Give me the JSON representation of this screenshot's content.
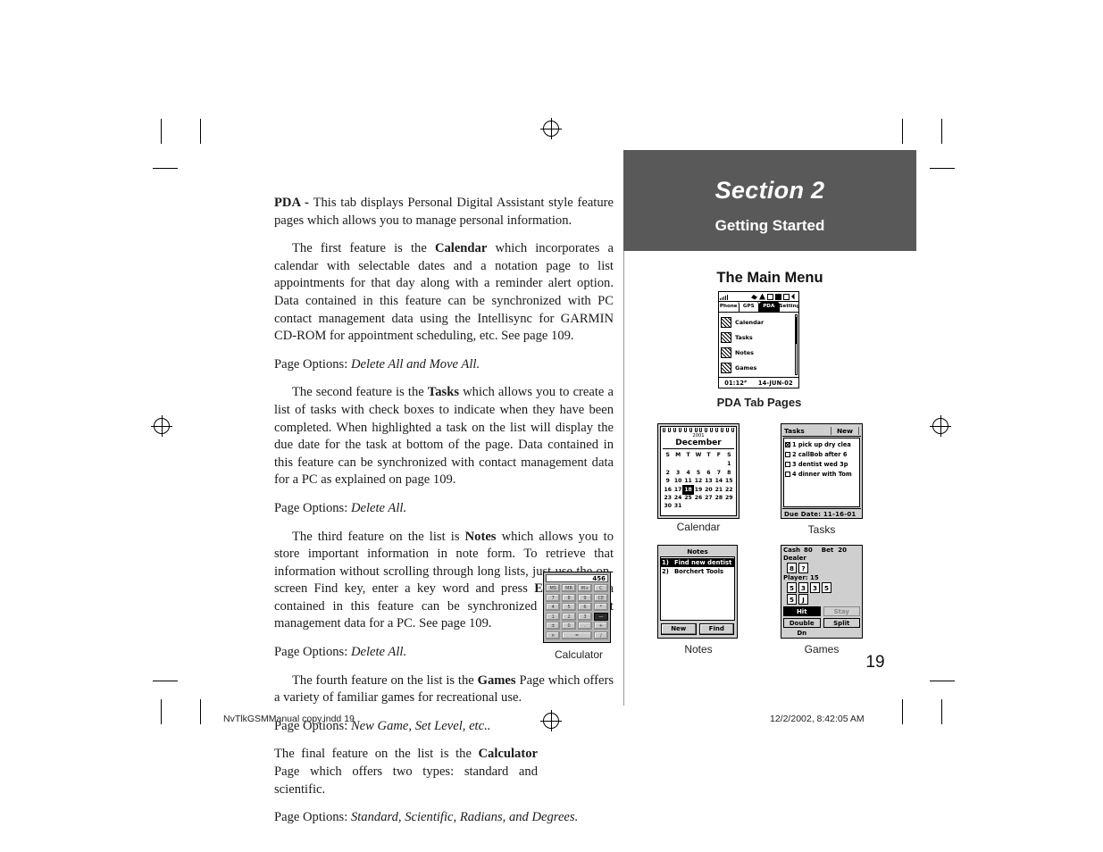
{
  "document": {
    "page_number": "19",
    "footer_left": "NvTlkGSMManual copy.indd   19",
    "footer_right": "12/2/2002, 8:42:05 AM"
  },
  "section": {
    "title": "Section 2",
    "subtitle": "Getting Started",
    "heading": "The Main Menu"
  },
  "body": {
    "p1_bold": "PDA - ",
    "p1": "This tab displays Personal Digital Assistant style feature pages which allows you to manage personal information.",
    "p2_a": "The first feature is the ",
    "p2_bold": "Calendar",
    "p2_b": " which incorporates a calendar with selectable dates and a notation page to list appointments for that day along with a reminder alert option. Data contained in this feature can be synchronized with PC contact management data using the Intellisync for GARMIN CD-ROM for appointment scheduling, etc. See page 109.",
    "opt1_label": "Page Options: ",
    "opt1_value": "Delete All and Move All.",
    "p3_a": "The second feature is the ",
    "p3_bold": "Tasks",
    "p3_b": " which allows you to create a list of tasks with check boxes to indicate when they have been completed. When highlighted a task on the list will display the due date for the task at bottom of the page. Data contained in this feature can be synchronized with contact management data for a PC as explained on page 109.",
    "opt2_label": "Page Options: ",
    "opt2_value": "Delete All.",
    "p4_a": "The third feature on the list is ",
    "p4_bold": "Notes",
    "p4_b": " which allows you to store important information in note form. To retrieve that information without scrolling through long lists, just use the on-screen Find key, enter a key word and press ",
    "p4_bold2": "ENTER",
    "p4_c": ". Data contained in this feature can be synchronized with contact management data for a PC. See page 109.",
    "opt3_label": "Page Options: ",
    "opt3_value": "Delete All.",
    "p5_a": "The fourth feature on the list is the ",
    "p5_bold": "Games",
    "p5_b": " Page which offers a variety of familiar games for recreational use.",
    "opt4_label": "Page Options: ",
    "opt4_value": "New Game, Set Level, etc..",
    "p6_a": "The final feature on the list is the ",
    "p6_bold": "Calculator",
    "p6_b": " Page which offers two types: standard and scientific.",
    "opt5_label": "Page Options: ",
    "opt5_value": "Standard, Scientific, Radians, and Degrees."
  },
  "captions": {
    "pda_tab_pages": "PDA Tab Pages",
    "calendar": "Calendar",
    "tasks": "Tasks",
    "notes": "Notes",
    "games": "Games",
    "calculator": "Calculator"
  },
  "main_menu": {
    "tabs": [
      {
        "label": "Phone",
        "active": false
      },
      {
        "label": "GPS",
        "active": false
      },
      {
        "label": "PDA",
        "active": true
      },
      {
        "label": "Settings",
        "active": false
      }
    ],
    "items": [
      {
        "label": "Calendar",
        "icon": "calendar-icon"
      },
      {
        "label": "Tasks",
        "icon": "tasks-icon"
      },
      {
        "label": "Notes",
        "icon": "notes-icon"
      },
      {
        "label": "Games",
        "icon": "games-icon"
      }
    ],
    "time": "01:12ᴾ",
    "date": "14-JUN-02"
  },
  "calendar_screen": {
    "year": "2001",
    "month": "December",
    "dow": [
      "S",
      "M",
      "T",
      "W",
      "T",
      "F",
      "S"
    ],
    "cells": [
      "",
      "",
      "",
      "",
      "",
      "",
      "1",
      "2",
      "3",
      "4",
      "5",
      "6",
      "7",
      "8",
      "9",
      "10",
      "11",
      "12",
      "13",
      "14",
      "15",
      "16",
      "17",
      "18",
      "19",
      "20",
      "21",
      "22",
      "23",
      "24",
      "25",
      "26",
      "27",
      "28",
      "29",
      "30",
      "31",
      "",
      "",
      "",
      "",
      ""
    ],
    "selected": "18"
  },
  "tasks_screen": {
    "title": "Tasks",
    "new_button": "New",
    "rows": [
      {
        "checked": true,
        "text": "1 pick up dry clea"
      },
      {
        "checked": false,
        "text": "2 callBob after 6"
      },
      {
        "checked": false,
        "text": "3 dentist wed 3p"
      },
      {
        "checked": false,
        "text": "4 dinner with Tom"
      }
    ],
    "footer": "Due Date: 11-16-01"
  },
  "notes_screen": {
    "title": "Notes",
    "rows": [
      {
        "num": "1)",
        "text": "Find new dentist",
        "selected": true
      },
      {
        "num": "2)",
        "text": "Borchert Tools",
        "selected": false
      }
    ],
    "buttons": [
      "New",
      "Find"
    ]
  },
  "games_screen": {
    "cash_label": "Cash",
    "cash_value": "80",
    "bet_label": "Bet",
    "bet_value": "20",
    "dealer_label": "Dealer",
    "dealer_cards": [
      "8",
      "?"
    ],
    "player_label": "Player: 15",
    "player_cards_row1": [
      "5",
      "3",
      "3",
      "5"
    ],
    "player_cards_row2": [
      "5",
      "J"
    ],
    "buttons": [
      {
        "label": "Hit",
        "state": "selected"
      },
      {
        "label": "Stay",
        "state": "disabled"
      },
      {
        "label": "Double Dn",
        "state": "normal"
      },
      {
        "label": "Split",
        "state": "normal"
      }
    ]
  },
  "calculator_screen": {
    "display": "456",
    "keys": [
      {
        "label": "MS",
        "style": "normal"
      },
      {
        "label": "MR",
        "style": "normal"
      },
      {
        "label": "M+",
        "style": "normal"
      },
      {
        "label": "C",
        "style": "normal"
      },
      {
        "label": "7",
        "style": "normal"
      },
      {
        "label": "8",
        "style": "normal"
      },
      {
        "label": "9",
        "style": "normal"
      },
      {
        "label": "CE",
        "style": "normal"
      },
      {
        "label": "4",
        "style": "normal"
      },
      {
        "label": "5",
        "style": "normal"
      },
      {
        "label": "6",
        "style": "normal"
      },
      {
        "label": "*",
        "style": "normal"
      },
      {
        "label": "1",
        "style": "normal"
      },
      {
        "label": "2",
        "style": "normal"
      },
      {
        "label": "3",
        "style": "normal"
      },
      {
        "label": "—",
        "style": "dark"
      },
      {
        "label": "±",
        "style": "normal"
      },
      {
        "label": "0",
        "style": "normal"
      },
      {
        "label": ".",
        "style": "normal"
      },
      {
        "label": "+",
        "style": "normal"
      },
      {
        "label": "×",
        "style": "normal"
      },
      {
        "label": "=",
        "style": "wide"
      },
      {
        "label": "/",
        "style": "normal"
      }
    ]
  },
  "colors": {
    "banner": "#595959",
    "device_shell": "#cfcfcf",
    "calculator_body": "#b5b5b5"
  }
}
